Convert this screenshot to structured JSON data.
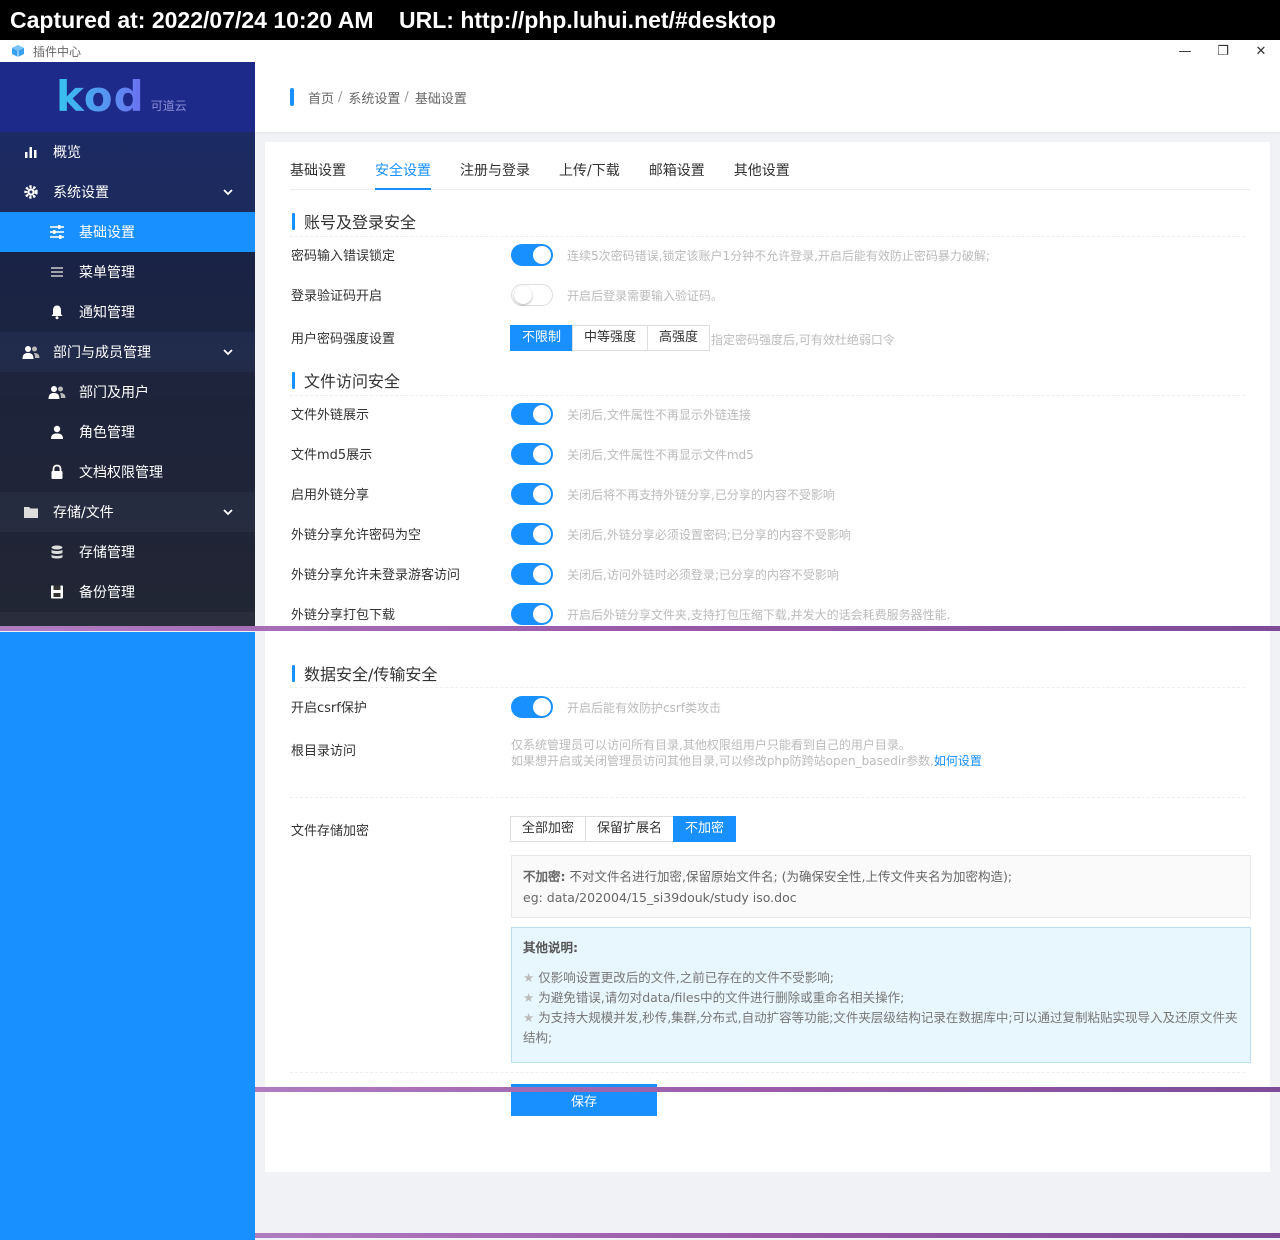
{
  "capture": {
    "text": "Captured at: 2022/07/24 10:20 AM    URL: http://php.luhui.net/#desktop"
  },
  "window": {
    "title": "插件中心",
    "minimize": "—",
    "restore": "❐",
    "close": "✕"
  },
  "logo": {
    "text": "kod",
    "sub": "可道云"
  },
  "sidebar": {
    "items": [
      {
        "label": "概览",
        "icon": "bar-chart-icon"
      },
      {
        "label": "系统设置",
        "icon": "gear-icon"
      },
      {
        "label": "基础设置",
        "icon": "sliders-icon"
      },
      {
        "label": "菜单管理",
        "icon": "menu-icon"
      },
      {
        "label": "通知管理",
        "icon": "bell-icon"
      },
      {
        "label": "部门与成员管理",
        "icon": "users-icon"
      },
      {
        "label": "部门及用户",
        "icon": "users-icon"
      },
      {
        "label": "角色管理",
        "icon": "user-icon"
      },
      {
        "label": "文档权限管理",
        "icon": "lock-icon"
      },
      {
        "label": "存储/文件",
        "icon": "folder-icon"
      },
      {
        "label": "存储管理",
        "icon": "database-icon"
      },
      {
        "label": "备份管理",
        "icon": "save-icon"
      }
    ]
  },
  "breadcrumb": {
    "home": "首页",
    "level1": "系统设置",
    "level2": "基础设置",
    "sep": "/"
  },
  "tabs": [
    "基础设置",
    "安全设置",
    "注册与登录",
    "上传/下载",
    "邮箱设置",
    "其他设置"
  ],
  "sections": {
    "account": "账号及登录安全",
    "file_access": "文件访问安全",
    "data": "数据安全/传输安全"
  },
  "account_rows": [
    {
      "label": "密码输入错误锁定",
      "on": true,
      "desc": "连续5次密码错误,锁定该账户1分钟不允许登录,开启后能有效防止密码暴力破解;"
    },
    {
      "label": "登录验证码开启",
      "on": false,
      "desc": "开启后登录需要输入验证码。"
    }
  ],
  "password_strength": {
    "label": "用户密码强度设置",
    "options": [
      "不限制",
      "中等强度",
      "高强度"
    ],
    "selected": "不限制",
    "desc": "指定密码强度后,可有效杜绝弱口令"
  },
  "file_rows": [
    {
      "label": "文件外链展示",
      "on": true,
      "desc": "关闭后,文件属性不再显示外链连接"
    },
    {
      "label": "文件md5展示",
      "on": true,
      "desc": "关闭后,文件属性不再显示文件md5"
    },
    {
      "label": "启用外链分享",
      "on": true,
      "desc": "关闭后将不再支持外链分享,已分享的内容不受影响"
    },
    {
      "label": "外链分享允许密码为空",
      "on": true,
      "desc": "关闭后,外链分享必须设置密码;已分享的内容不受影响"
    },
    {
      "label": "外链分享允许未登录游客访问",
      "on": true,
      "desc": "关闭后,访问外链时必须登录;已分享的内容不受影响"
    },
    {
      "label": "外链分享打包下载",
      "on": true,
      "desc": "开启后外链分享文件夹,支持打包压缩下载,并发大的话会耗费服务器性能."
    }
  ],
  "csrf": {
    "label": "开启csrf保护",
    "on": true,
    "desc": "开启后能有效防护csrf类攻击"
  },
  "root_access": {
    "label": "根目录访问",
    "line1": "仅系统管理员可以访问所有目录,其他权限组用户只能看到自己的用户目录。",
    "line2": "如果想开启或关闭管理员访问其他目录,可以修改php防跨站open_basedir参数,",
    "link": "如何设置"
  },
  "encryption": {
    "label": "文件存储加密",
    "options": [
      "全部加密",
      "保留扩展名",
      "不加密"
    ],
    "selected": "不加密",
    "info_title": "不加密:",
    "info_text": " 不对文件名进行加密,保留原始文件名; (为确保安全性,上传文件夹名为加密构造);",
    "info_example": "eg: data/202004/15_si39douk/study iso.doc"
  },
  "notes": {
    "title": "其他说明:",
    "items": [
      "仅影响设置更改后的文件,之前已存在的文件不受影响;",
      "为避免错误,请勿对data/files中的文件进行删除或重命名相关操作;",
      "为支持大规模并发,秒传,集群,分布式,自动扩容等功能;文件夹层级结构记录在数据库中;可以通过复制粘贴实现导入及还原文件夹结构;"
    ]
  },
  "save_label": "保存",
  "colors": {
    "accent": "#1890ff",
    "sidebar_dark": "#1e2a8a"
  }
}
